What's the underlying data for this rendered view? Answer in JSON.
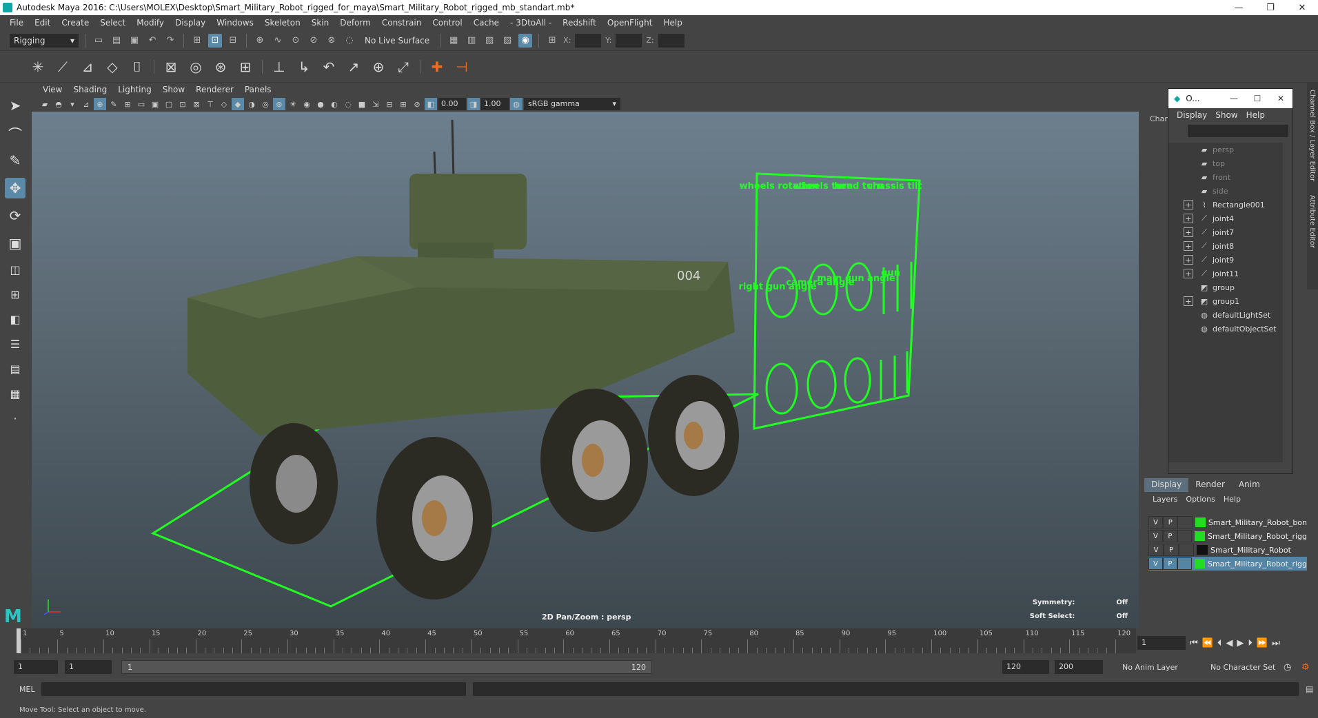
{
  "window": {
    "title": "Autodesk Maya 2016: C:\\Users\\MOLEX\\Desktop\\Smart_Military_Robot_rigged_for_maya\\Smart_Military_Robot_rigged_mb_standart.mb*",
    "minimize": "—",
    "maximize": "❐",
    "close": "✕"
  },
  "menubar": [
    "File",
    "Edit",
    "Create",
    "Select",
    "Modify",
    "Display",
    "Windows",
    "Skeleton",
    "Skin",
    "Deform",
    "Constrain",
    "Control",
    "Cache",
    "- 3DtoAll -",
    "Redshift",
    "OpenFlight",
    "Help"
  ],
  "statusline": {
    "menu_set": "Rigging",
    "live_surface": "No Live Surface",
    "x_label": "X:",
    "y_label": "Y:",
    "z_label": "Z:"
  },
  "viewport_menu": [
    "View",
    "Shading",
    "Lighting",
    "Show",
    "Renderer",
    "Panels"
  ],
  "viewport_toolbar": {
    "exposure": "0.00",
    "gamma_value": "1.00",
    "color_space": "sRGB gamma"
  },
  "viewport": {
    "hud_camera": "2D Pan/Zoom : persp",
    "symmetry_label": "Symmetry:",
    "symmetry_value": "Off",
    "soft_select_label": "Soft Select:",
    "soft_select_value": "Off",
    "vehicle_number": "004",
    "control_labels": [
      "wheels rotation",
      "wheels turn",
      "head turn",
      "chassis tilt",
      "right gun angle",
      "camera angle",
      "main gun angle",
      "gun"
    ]
  },
  "outliner": {
    "title": "O...",
    "menu": [
      "Display",
      "Show",
      "Help"
    ],
    "items": [
      {
        "label": "persp",
        "expandable": false,
        "dim": true,
        "icon": "camera-icon"
      },
      {
        "label": "top",
        "expandable": false,
        "dim": true,
        "icon": "camera-icon"
      },
      {
        "label": "front",
        "expandable": false,
        "dim": true,
        "icon": "camera-icon"
      },
      {
        "label": "side",
        "expandable": false,
        "dim": true,
        "icon": "camera-icon"
      },
      {
        "label": "Rectangle001",
        "expandable": true,
        "dim": false,
        "icon": "curve-icon"
      },
      {
        "label": "joint4",
        "expandable": true,
        "dim": false,
        "icon": "joint-icon"
      },
      {
        "label": "joint7",
        "expandable": true,
        "dim": false,
        "icon": "joint-icon"
      },
      {
        "label": "joint8",
        "expandable": true,
        "dim": false,
        "icon": "joint-icon"
      },
      {
        "label": "joint9",
        "expandable": true,
        "dim": false,
        "icon": "joint-icon"
      },
      {
        "label": "joint11",
        "expandable": true,
        "dim": false,
        "icon": "joint-icon"
      },
      {
        "label": "group",
        "expandable": false,
        "dim": false,
        "icon": "group-icon"
      },
      {
        "label": "group1",
        "expandable": true,
        "dim": false,
        "icon": "group-icon"
      },
      {
        "label": "defaultLightSet",
        "expandable": false,
        "dim": false,
        "icon": "set-icon"
      },
      {
        "label": "defaultObjectSet",
        "expandable": false,
        "dim": false,
        "icon": "set-icon"
      }
    ]
  },
  "channel_box_label": "Chan",
  "side_tabs": [
    "Channel Box / Layer Editor",
    "Attribute Editor"
  ],
  "layer_editor": {
    "tabs": [
      "Display",
      "Render",
      "Anim"
    ],
    "menu": [
      "Layers",
      "Options",
      "Help"
    ],
    "layers": [
      {
        "v": "V",
        "p": "P",
        "color": "#22dd22",
        "name": "Smart_Military_Robot_bon",
        "selected": false
      },
      {
        "v": "V",
        "p": "P",
        "color": "#22dd22",
        "name": "Smart_Military_Robot_rigg",
        "selected": false
      },
      {
        "v": "V",
        "p": "P",
        "color": "#111111",
        "name": "Smart_Military_Robot",
        "selected": false
      },
      {
        "v": "V",
        "p": "P",
        "color": "#22dd22",
        "name": "Smart_Military_Robot_rigg",
        "selected": true
      }
    ]
  },
  "timeline": {
    "labels": [
      "1",
      "5",
      "10",
      "15",
      "20",
      "25",
      "30",
      "35",
      "40",
      "45",
      "50",
      "55",
      "60",
      "65",
      "70",
      "75",
      "80",
      "85",
      "90",
      "95",
      "100",
      "105",
      "110",
      "115",
      "120"
    ],
    "current_frame": "1"
  },
  "range": {
    "start": "1",
    "playback_start": "1",
    "slider_start": "1",
    "slider_end": "120",
    "playback_end": "120",
    "end": "200",
    "anim_layer": "No Anim Layer",
    "character_set": "No Character Set"
  },
  "mel_label": "MEL",
  "help_line": "Move Tool: Select an object to move."
}
